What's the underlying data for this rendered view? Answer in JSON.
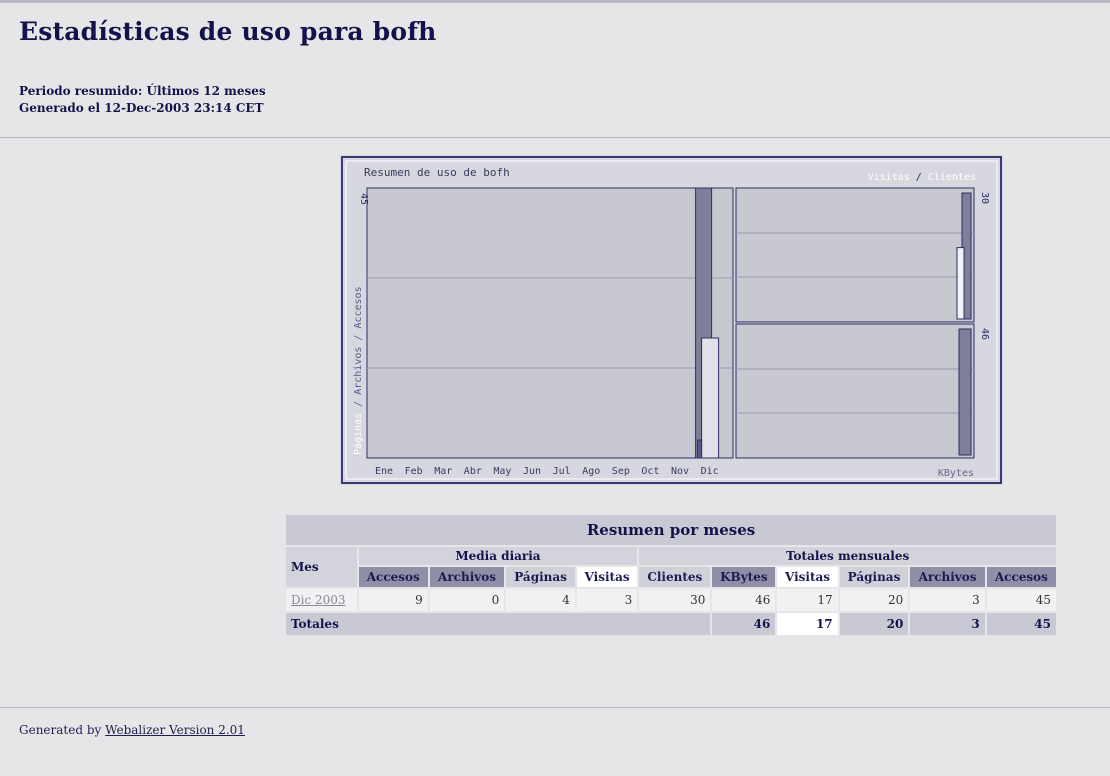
{
  "page": {
    "title": "Estadísticas de uso para bofh",
    "period": "Periodo resumido: Últimos 12 meses",
    "generated": "Generado el 12-Dec-2003 23:14 CET"
  },
  "chart": {
    "title": "Resumen de uso de bofh",
    "legend_visitas": "Visitas",
    "legend_sep": " / ",
    "legend_clientes": "Clientes",
    "ylabel_paginas": "Páginas",
    "ylabel_rest": " / Archivos / Accesos",
    "months": [
      "Ene",
      "Feb",
      "Mar",
      "Abr",
      "May",
      "Jun",
      "Jul",
      "Ago",
      "Sep",
      "Oct",
      "Nov",
      "Dic"
    ],
    "left_max_label": "45",
    "right_top_max_label": "30",
    "right_bottom_max_label": "46",
    "right_bottom_label": "KBytes",
    "colors": {
      "accesos": "#7f7f9a",
      "archivos": "#5a5a86",
      "paginas": "#e1e1e7",
      "visitas": "#7f7f9a",
      "clientes": "#f3f3f6",
      "kbytes": "#7f7f9a"
    }
  },
  "chart_data": [
    {
      "type": "bar",
      "title": "Resumen de uso de bofh",
      "categories": [
        "Ene",
        "Feb",
        "Mar",
        "Abr",
        "May",
        "Jun",
        "Jul",
        "Ago",
        "Sep",
        "Oct",
        "Nov",
        "Dic"
      ],
      "series": [
        {
          "name": "Accesos",
          "values": [
            0,
            0,
            0,
            0,
            0,
            0,
            0,
            0,
            0,
            0,
            0,
            45
          ]
        },
        {
          "name": "Archivos",
          "values": [
            0,
            0,
            0,
            0,
            0,
            0,
            0,
            0,
            0,
            0,
            0,
            3
          ]
        },
        {
          "name": "Páginas",
          "values": [
            0,
            0,
            0,
            0,
            0,
            0,
            0,
            0,
            0,
            0,
            0,
            20
          ]
        }
      ],
      "ylabel": "Páginas / Archivos / Accesos",
      "ylim": [
        0,
        45
      ],
      "grid": true
    },
    {
      "type": "bar",
      "categories": [
        "Dic 2003"
      ],
      "series": [
        {
          "name": "Visitas",
          "values": [
            17
          ]
        },
        {
          "name": "Clientes",
          "values": [
            30
          ]
        }
      ],
      "ylim": [
        0,
        30
      ],
      "grid": true
    },
    {
      "type": "bar",
      "categories": [
        "Dic 2003"
      ],
      "series": [
        {
          "name": "KBytes",
          "values": [
            46
          ]
        }
      ],
      "ylabel": "KBytes",
      "ylim": [
        0,
        46
      ],
      "grid": true
    }
  ],
  "table": {
    "title": "Resumen por meses",
    "col_mes": "Mes",
    "group_daily": "Media diaria",
    "group_monthly": "Totales mensuales",
    "daily_headers": [
      "Accesos",
      "Archivos",
      "Páginas",
      "Visitas"
    ],
    "monthly_headers": [
      "Clientes",
      "KBytes",
      "Visitas",
      "Páginas",
      "Archivos",
      "Accesos"
    ],
    "rows": [
      {
        "month": "Dic 2003",
        "daily": [
          "9",
          "0",
          "4",
          "3"
        ],
        "monthly": [
          "30",
          "46",
          "17",
          "20",
          "3",
          "45"
        ]
      }
    ],
    "totals_label": "Totales",
    "totals": [
      "46",
      "17",
      "20",
      "3",
      "45"
    ]
  },
  "footer": {
    "prefix": "Generated by ",
    "link": "Webalizer Version 2.01"
  }
}
